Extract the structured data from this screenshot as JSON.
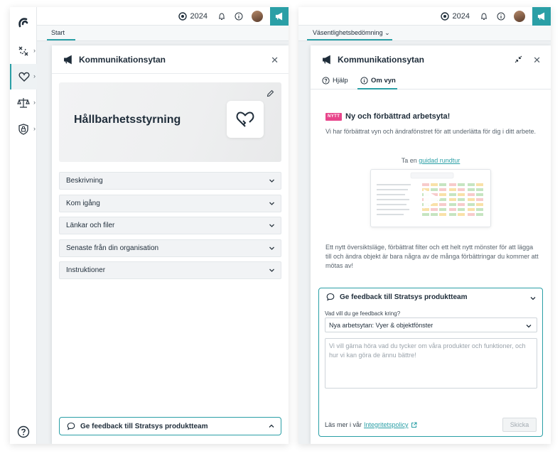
{
  "colors": {
    "accent": "#2a9fa6",
    "badge": "#e8458b",
    "text": "#1f2d3a"
  },
  "left": {
    "topbar": {
      "year": "2024"
    },
    "subnav": {
      "active_tab": "Start"
    },
    "panel": {
      "title": "Kommunikationsytan",
      "hero_title": "Hållbarhetsstyrning",
      "accordions": [
        "Beskrivning",
        "Kom igång",
        "Länkar och filer",
        "Senaste från din organisation",
        "Instruktioner"
      ],
      "feedback_button": "Ge feedback till Stratsys produktteam"
    },
    "rail": {
      "items": [
        "goals-icon",
        "heart-icon",
        "scale-icon",
        "shield-lock-icon"
      ]
    }
  },
  "right": {
    "topbar": {
      "year": "2024"
    },
    "subnav": {
      "active_tab": "Väsentlighetsbedömning"
    },
    "panel": {
      "title": "Kommunikationsytan",
      "tabs": [
        {
          "label": "Hjälp"
        },
        {
          "label": "Om vyn"
        }
      ],
      "badge": "NYTT",
      "heading": "Ny och förbättrad arbetsyta!",
      "intro": "Vi har förbättrat vyn och ändrafönstret för att underlätta för dig i ditt arbete.",
      "tour_prefix": "Ta en",
      "tour_link": "guidad rundtur",
      "body": "Ett nytt översiktsläge, förbättrat filter och ett helt nytt mönster för att lägga till och ändra objekt är bara några av de många förbättringar du kommer att mötas av!",
      "feedback": {
        "title": "Ge feedback till Stratsys produktteam",
        "question_label": "Vad vill du ge feedback kring?",
        "selected": "Nya arbetsytan: Vyer & objektfönster",
        "placeholder": "Vi vill gärna höra vad du tycker om våra produkter och funktioner, och hur vi kan göra de ännu bättre!",
        "privacy_prefix": "Läs mer i vår",
        "privacy_link": "Integritetspolicy",
        "send": "Skicka"
      }
    }
  }
}
